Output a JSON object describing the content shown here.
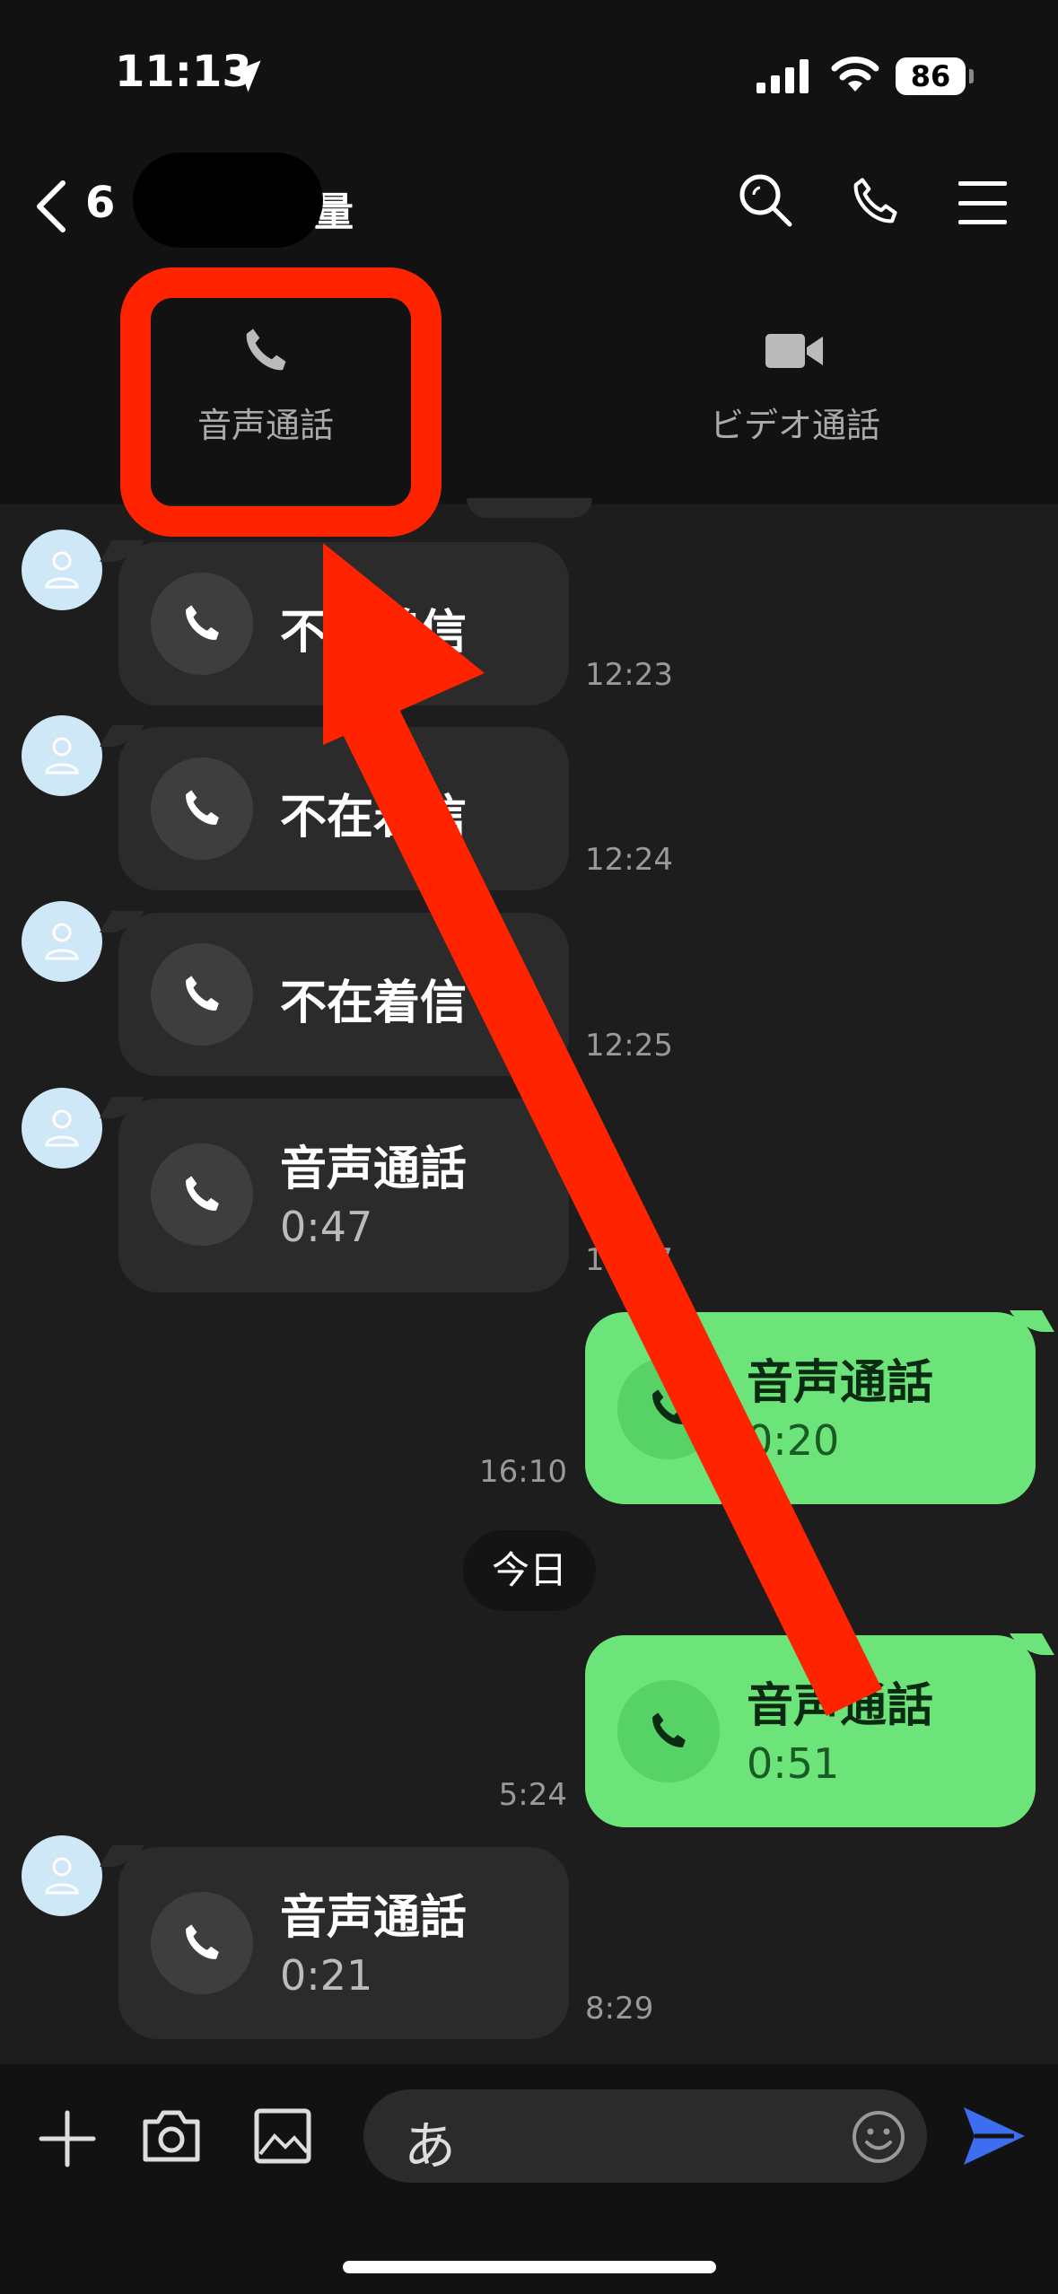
{
  "status_bar": {
    "time": "11:13",
    "battery": "86"
  },
  "header": {
    "back_count": "6",
    "name_tail": "量",
    "icons": [
      "search-icon",
      "phone-icon",
      "menu-icon"
    ]
  },
  "call_options": {
    "voice": "音声通話",
    "video": "ビデオ通話"
  },
  "messages": [
    {
      "direction": "in",
      "title": "不在着信",
      "sub": "",
      "time": "12:23"
    },
    {
      "direction": "in",
      "title": "不在着信",
      "sub": "",
      "time": "12:24"
    },
    {
      "direction": "in",
      "title": "不在着信",
      "sub": "",
      "time": "12:25"
    },
    {
      "direction": "in",
      "title": "音声通話",
      "sub": "0:47",
      "time": "12:47"
    },
    {
      "direction": "out",
      "title": "音声通話",
      "sub": "0:20",
      "time": "16:10"
    },
    {
      "direction": "out",
      "title": "音声通話",
      "sub": "0:51",
      "time": "5:24"
    },
    {
      "direction": "in",
      "title": "音声通話",
      "sub": "0:21",
      "time": "8:29"
    }
  ],
  "date_divider": "今日",
  "input": {
    "value": "あ"
  },
  "colors": {
    "accent_annotation": "#ff2300",
    "outgoing_bubble": "#6de47a",
    "send": "#3d6df0"
  }
}
